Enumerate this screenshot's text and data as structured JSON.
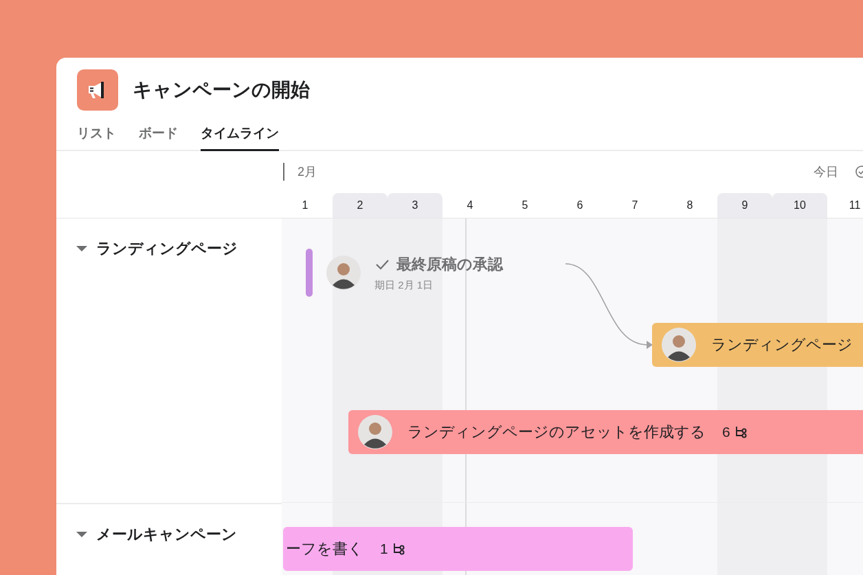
{
  "project": {
    "title": "キャンペーンの開始"
  },
  "tabs": [
    {
      "label": "リスト",
      "selected": false
    },
    {
      "label": "ボード",
      "selected": false
    },
    {
      "label": "タイムライン",
      "selected": true
    }
  ],
  "timeline": {
    "month": "2月",
    "today_button": "今日",
    "days": [
      {
        "label": "1",
        "weekend": false
      },
      {
        "label": "2",
        "weekend": true
      },
      {
        "label": "3",
        "weekend": true
      },
      {
        "label": "4",
        "weekend": false
      },
      {
        "label": "5",
        "weekend": false
      },
      {
        "label": "6",
        "weekend": false
      },
      {
        "label": "7",
        "weekend": false
      },
      {
        "label": "8",
        "weekend": false
      },
      {
        "label": "9",
        "weekend": true
      },
      {
        "label": "10",
        "weekend": true
      },
      {
        "label": "11",
        "weekend": false
      }
    ]
  },
  "sections": [
    {
      "name": "ランディングページ",
      "expanded": true
    },
    {
      "name": "メールキャンペーン",
      "expanded": true
    }
  ],
  "tasks": [
    {
      "kind": "milestone",
      "title": "最終原稿の承認",
      "completed": true,
      "due": "期日 2月 1日",
      "color": "#c48ee0"
    },
    {
      "kind": "bar",
      "title": "ランディングページ",
      "color": "#f1bd6c"
    },
    {
      "kind": "bar",
      "title": "ランディングページのアセットを作成する",
      "subtasks": "6",
      "color": "#fc979a"
    },
    {
      "kind": "bar",
      "title": "ーフを書く",
      "subtasks": "1",
      "color": "#f9aaef"
    }
  ]
}
